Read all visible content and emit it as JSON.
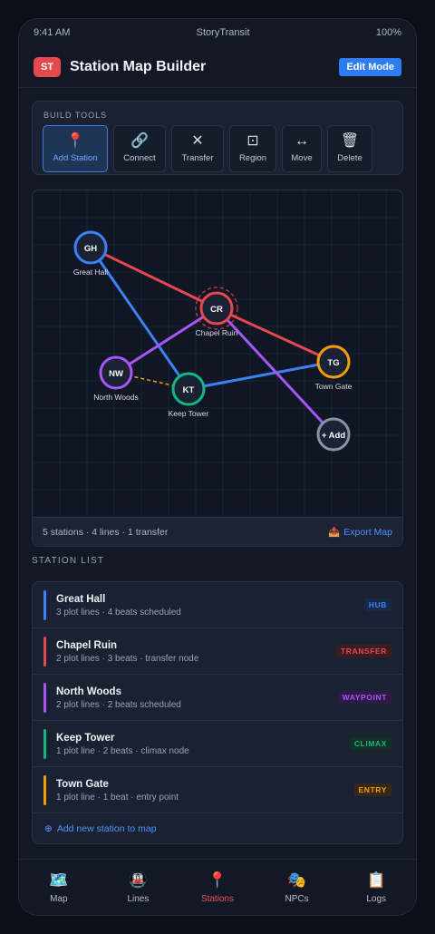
{
  "status_bar": {
    "time": "9:41 AM",
    "app_name": "StoryTransit",
    "battery": "100%"
  },
  "header": {
    "badge": "ST",
    "title": "Station Map Builder",
    "mode_button": "Edit Mode"
  },
  "tools": {
    "label": "BUILD TOOLS",
    "items": [
      {
        "label": "Add Station",
        "icon": "📍",
        "icon_name": "pin-icon",
        "active": true
      },
      {
        "label": "Connect",
        "icon": "🔗",
        "icon_name": "link-icon",
        "active": false
      },
      {
        "label": "Transfer",
        "icon": "✕",
        "icon_name": "transfer-icon",
        "active": false
      },
      {
        "label": "Region",
        "icon": "⊡",
        "icon_name": "region-icon",
        "active": false
      },
      {
        "label": "Move",
        "icon": "↔",
        "icon_name": "move-icon",
        "active": false
      },
      {
        "label": "Delete",
        "icon": "🗑",
        "icon_name": "trash-icon",
        "active": false
      }
    ]
  },
  "map": {
    "stations": [
      {
        "code": "GH",
        "name": "Great Hall",
        "color": "#3b82f6"
      },
      {
        "code": "CR",
        "name": "Chapel Ruin",
        "color": "#e5484d"
      },
      {
        "code": "NW",
        "name": "North Woods",
        "color": "#a855f7"
      },
      {
        "code": "KT",
        "name": "Keep Tower",
        "color": "#10b981"
      },
      {
        "code": "TG",
        "name": "Town Gate",
        "color": "#f59e0b"
      }
    ],
    "add_node": "+ Add",
    "summary": "5 stations · 4 lines · 1 transfer",
    "export_label": "Export Map"
  },
  "station_list": {
    "title": "STATION LIST",
    "items": [
      {
        "name": "Great Hall",
        "sub": "3 plot lines · 4 beats scheduled",
        "tag": "HUB",
        "color": "#3b82f6",
        "tag_bg": "#16294a"
      },
      {
        "name": "Chapel Ruin",
        "sub": "2 plot lines · 3 beats · transfer node",
        "tag": "TRANSFER",
        "color": "#e5484d",
        "tag_bg": "#3a1c22"
      },
      {
        "name": "North Woods",
        "sub": "2 plot lines · 2 beats scheduled",
        "tag": "WAYPOINT",
        "color": "#a855f7",
        "tag_bg": "#2e1a45"
      },
      {
        "name": "Keep Tower",
        "sub": "1 plot line · 2 beats · climax node",
        "tag": "CLIMAX",
        "color": "#10b981",
        "tag_bg": "#123026"
      },
      {
        "name": "Town Gate",
        "sub": "1 plot line · 1 beat · entry point",
        "tag": "ENTRY",
        "color": "#f59e0b",
        "tag_bg": "#35281a"
      }
    ],
    "add_label": "Add new station to map"
  },
  "nav": {
    "items": [
      {
        "label": "Map",
        "icon": "🗺️",
        "icon_name": "map-icon",
        "active": false
      },
      {
        "label": "Lines",
        "icon": "🚇",
        "icon_name": "train-icon",
        "active": false
      },
      {
        "label": "Stations",
        "icon": "📍",
        "icon_name": "pin-icon",
        "active": true
      },
      {
        "label": "NPCs",
        "icon": "🎭",
        "icon_name": "masks-icon",
        "active": false
      },
      {
        "label": "Logs",
        "icon": "📋",
        "icon_name": "clipboard-icon",
        "active": false
      }
    ]
  }
}
